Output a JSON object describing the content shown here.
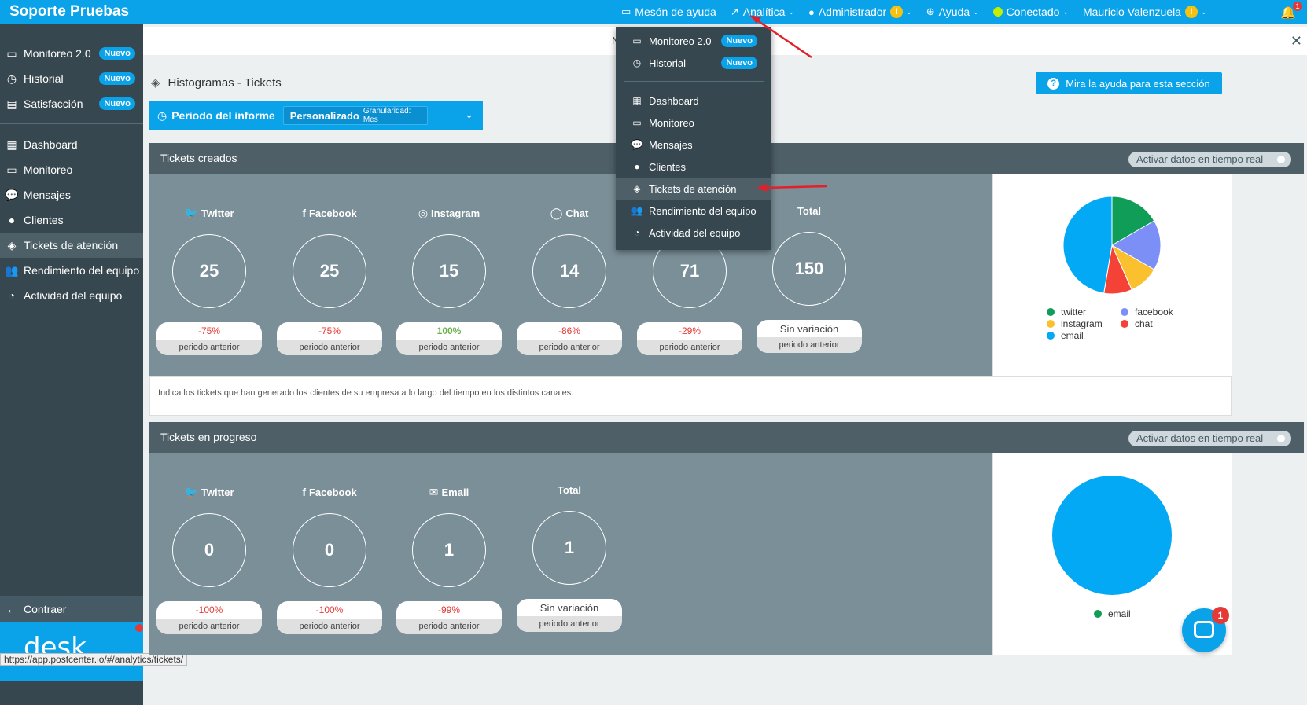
{
  "app": {
    "title": "Soporte Pruebas"
  },
  "topnav": {
    "items": [
      {
        "label": "Mesón de ayuda",
        "icon": "monitor-icon"
      },
      {
        "label": "Analítica",
        "icon": "trend-icon"
      },
      {
        "label": "Administrador",
        "icon": "user-icon",
        "warn": "!"
      },
      {
        "label": "Ayuda",
        "icon": "lifebuoy-icon"
      },
      {
        "label": "Conectado",
        "icon": "status-dot-icon"
      },
      {
        "label": "Mauricio Valenzuela",
        "warn": "!"
      }
    ],
    "bell_count": "1"
  },
  "sidebar": {
    "top_items": [
      {
        "label": "Monitoreo 2.0",
        "badge": "Nuevo"
      },
      {
        "label": "Historial",
        "badge": "Nuevo"
      },
      {
        "label": "Satisfacción",
        "badge": "Nuevo"
      }
    ],
    "items": [
      {
        "label": "Dashboard"
      },
      {
        "label": "Monitoreo"
      },
      {
        "label": "Mensajes"
      },
      {
        "label": "Clientes"
      },
      {
        "label": "Tickets de atención"
      },
      {
        "label": "Rendimiento del equipo"
      },
      {
        "label": "Actividad del equipo"
      }
    ],
    "collapse_label": "Contraer",
    "desk_label": "desk"
  },
  "status_url": "https://app.postcenter.io/#/analytics/tickets/",
  "notice": {
    "text": "N"
  },
  "page": {
    "title": "Histogramas - Tickets",
    "help_button": "Mira la ayuda para esta sección",
    "period": {
      "label": "Periodo del informe",
      "value": "Personalizado",
      "granularity": "Granularidad: Mes"
    }
  },
  "panel1": {
    "title": "Tickets creados",
    "realtime_label": "Activar datos en tiempo real",
    "footer": "Indica los tickets que han generado los clientes de su empresa a lo largo del tiempo en los distintos canales.",
    "channels": [
      {
        "name": "Twitter",
        "value": "25",
        "variation": "-75%",
        "prev": "periodo anterior"
      },
      {
        "name": "Facebook",
        "value": "25",
        "variation": "-75%",
        "prev": "periodo anterior"
      },
      {
        "name": "Instagram",
        "value": "15",
        "variation": "100%",
        "prev": "periodo anterior"
      },
      {
        "name": "Chat",
        "value": "14",
        "variation": "-86%",
        "prev": "periodo anterior"
      },
      {
        "name": "",
        "value": "71",
        "variation": "-29%",
        "prev": "periodo anterior"
      },
      {
        "name": "Total",
        "value": "150",
        "variation": "Sin variación",
        "prev": "periodo anterior"
      }
    ],
    "legend": [
      "twitter",
      "facebook",
      "instagram",
      "chat",
      "email"
    ]
  },
  "panel2": {
    "title": "Tickets en progreso",
    "realtime_label": "Activar datos en tiempo real",
    "channels": [
      {
        "name": "Twitter",
        "value": "0",
        "variation": "-100%",
        "prev": "periodo anterior"
      },
      {
        "name": "Facebook",
        "value": "0",
        "variation": "-100%",
        "prev": "periodo anterior"
      },
      {
        "name": "Email",
        "value": "1",
        "variation": "-99%",
        "prev": "periodo anterior"
      },
      {
        "name": "Total",
        "value": "1",
        "variation": "Sin variación",
        "prev": "periodo anterior"
      }
    ],
    "legend": [
      "email"
    ]
  },
  "dropdown": {
    "top_items": [
      {
        "label": "Monitoreo 2.0",
        "badge": "Nuevo"
      },
      {
        "label": "Historial",
        "badge": "Nuevo"
      }
    ],
    "items": [
      {
        "label": "Dashboard"
      },
      {
        "label": "Monitoreo"
      },
      {
        "label": "Mensajes"
      },
      {
        "label": "Clientes"
      },
      {
        "label": "Tickets de atención"
      },
      {
        "label": "Rendimiento del equipo"
      },
      {
        "label": "Actividad del equipo"
      }
    ]
  },
  "chat_widget": {
    "badge": "1"
  },
  "colors": {
    "twitter": "#0f9d58",
    "facebook": "#7b8ff7",
    "instagram": "#fbc02d",
    "chat": "#f44336",
    "email": "#03a9f4",
    "brand": "#0aa3ea",
    "sidebar": "#37474f"
  },
  "chart_data": [
    {
      "type": "pie",
      "title": "",
      "categories": [
        "twitter",
        "facebook",
        "instagram",
        "chat",
        "email"
      ],
      "values": [
        25,
        25,
        15,
        14,
        71
      ]
    },
    {
      "type": "pie",
      "title": "",
      "categories": [
        "email"
      ],
      "values": [
        1
      ]
    }
  ]
}
